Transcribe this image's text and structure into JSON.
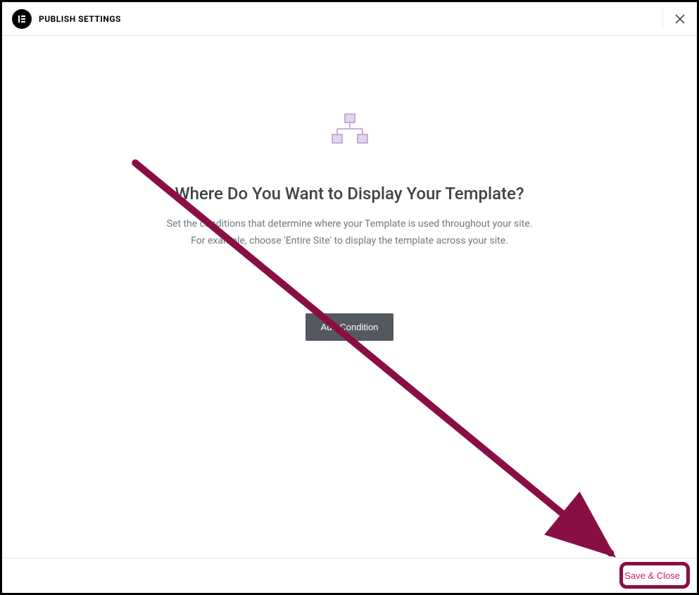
{
  "header": {
    "logo_text": "E",
    "title": "PUBLISH SETTINGS"
  },
  "main": {
    "heading": "Where Do You Want to Display Your Template?",
    "subtext_line1": "Set the conditions that determine where your Template is used throughout your site.",
    "subtext_line2": "For example, choose 'Entire Site' to display the template across your site.",
    "add_condition_label": "Add Condition"
  },
  "footer": {
    "save_close_label": "Save & Close"
  },
  "colors": {
    "accent_pink": "#d5127e",
    "annotation": "#8a0e46",
    "button_grey": "#54595f"
  }
}
